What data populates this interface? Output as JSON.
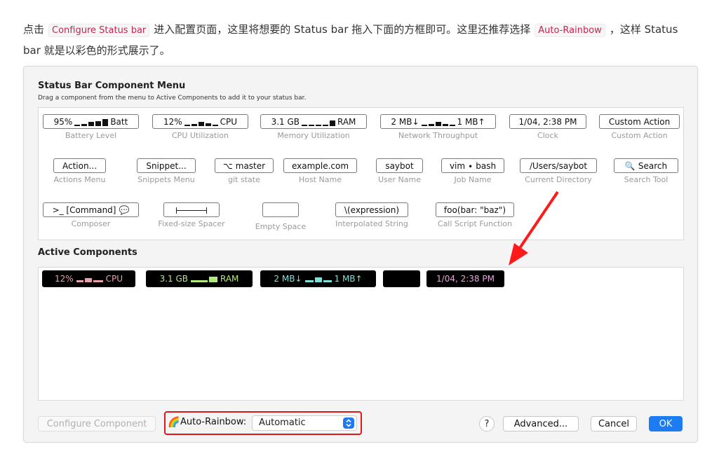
{
  "article": {
    "part1": "点击",
    "code1": "Configure Status bar",
    "part2": "进入配置页面，这里将想要的 Status bar 拖入下面的方框即可。这里还推荐选择",
    "code2": "Auto-Rainbow",
    "part3": "，这样 Status bar 就是以彩色的形式展示了。"
  },
  "panel": {
    "title": "Status Bar Component Menu",
    "subtitle": "Drag a component from the menu to Active Components to add it to your status bar.",
    "active_title": "Active Components"
  },
  "components": {
    "battery": {
      "pre": "95%",
      "post": "Batt",
      "label": "Battery Level"
    },
    "cpu": {
      "pre": "12%",
      "post": "CPU",
      "label": "CPU Utilization"
    },
    "memory": {
      "pre": "3.1 GB",
      "post": "RAM",
      "label": "Memory Utilization"
    },
    "network": {
      "pre": "2 MB↓",
      "post": "1 MB↑",
      "label": "Network Throughput"
    },
    "clock": {
      "text": "1/04, 2:38 PM",
      "label": "Clock"
    },
    "custom": {
      "text": "Custom Action",
      "label": "Custom Action"
    },
    "actions": {
      "text": "Action...",
      "label": "Actions Menu"
    },
    "snippets": {
      "text": "Snippet...",
      "label": "Snippets Menu"
    },
    "git": {
      "text": "master",
      "label": "git state"
    },
    "host": {
      "text": "example.com",
      "label": "Host Name"
    },
    "user": {
      "text": "saybot",
      "label": "User Name"
    },
    "job": {
      "text": "vim ∙ bash",
      "label": "Job Name"
    },
    "dir": {
      "text": "/Users/saybot",
      "label": "Current Directory"
    },
    "search": {
      "text": "Search",
      "label": "Search Tool"
    },
    "composer": {
      "text": ">_ [Command]",
      "label": "Composer"
    },
    "spacer": {
      "label": "Fixed-size Spacer"
    },
    "empty": {
      "label": "Empty Space"
    },
    "interp": {
      "text": "\\(expression)",
      "label": "Interpolated String"
    },
    "script": {
      "text": "foo(bar: \"baz\")",
      "label": "Call Script Function"
    }
  },
  "active": {
    "cpu": {
      "pre": "12%",
      "post": "CPU"
    },
    "ram": {
      "pre": "3.1 GB",
      "post": "RAM"
    },
    "net": {
      "pre": "2 MB↓",
      "post": "1 MB↑"
    },
    "clock": "1/04, 2:38 PM"
  },
  "footer": {
    "configure": "Configure Component",
    "auto_rainbow": "Auto-Rainbow:",
    "select_value": "Automatic",
    "help": "?",
    "advanced": "Advanced...",
    "cancel": "Cancel",
    "ok": "OK"
  },
  "colors": {
    "cpu": "#e8a0a8",
    "ram": "#b5e87a",
    "net": "#7fe0d8",
    "clock": "#f0a0e0",
    "ok": "#1d7cf2",
    "highlight": "#e3161a"
  }
}
